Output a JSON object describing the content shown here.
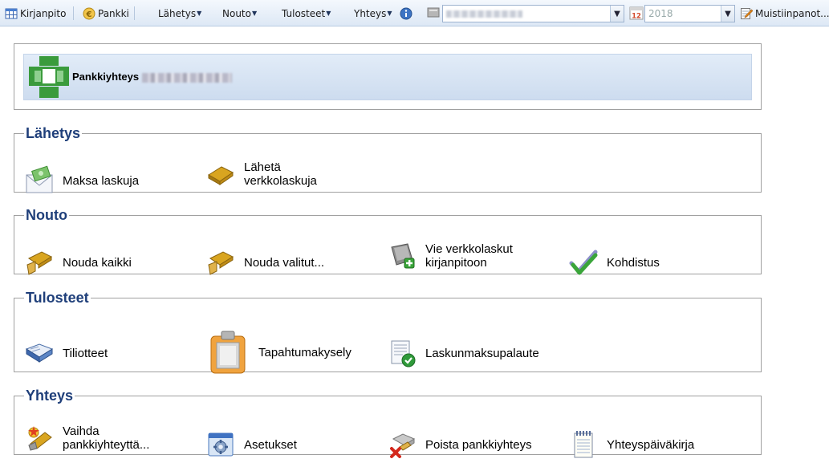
{
  "toolbar": {
    "kirjanpito": "Kirjanpito",
    "pankki": "Pankki",
    "lahetys": "Lähetys",
    "nouto": "Nouto",
    "tulosteet": "Tulosteet",
    "yhteys": "Yhteys",
    "year": "2018",
    "memo": "Muistiinpanot..."
  },
  "header": {
    "title": "Pankkiyhteys"
  },
  "sections": {
    "lahetys": {
      "title": "Lähetys",
      "items": [
        "Maksa laskuja",
        "Lähetä\nverkkolaskuja"
      ]
    },
    "nouto": {
      "title": "Nouto",
      "items": [
        "Nouda kaikki",
        "Nouda valitut...",
        "Vie verkkolaskut\nkirjanpitoon",
        "Kohdistus"
      ]
    },
    "tulosteet": {
      "title": "Tulosteet",
      "items": [
        "Tiliotteet",
        "Tapahtumakysely",
        "Laskunmaksupalaute"
      ]
    },
    "yhteys": {
      "title": "Yhteys",
      "items": [
        "Vaihda\npankkiyhteyttä...",
        "Asetukset",
        "Poista pankkiyhteys",
        "Yhteyspäiväkirja"
      ]
    }
  },
  "colors": {
    "section_title": "#1f3f7a",
    "toolbar_bg": "#dde8f5",
    "header_band": "#cddcef"
  }
}
